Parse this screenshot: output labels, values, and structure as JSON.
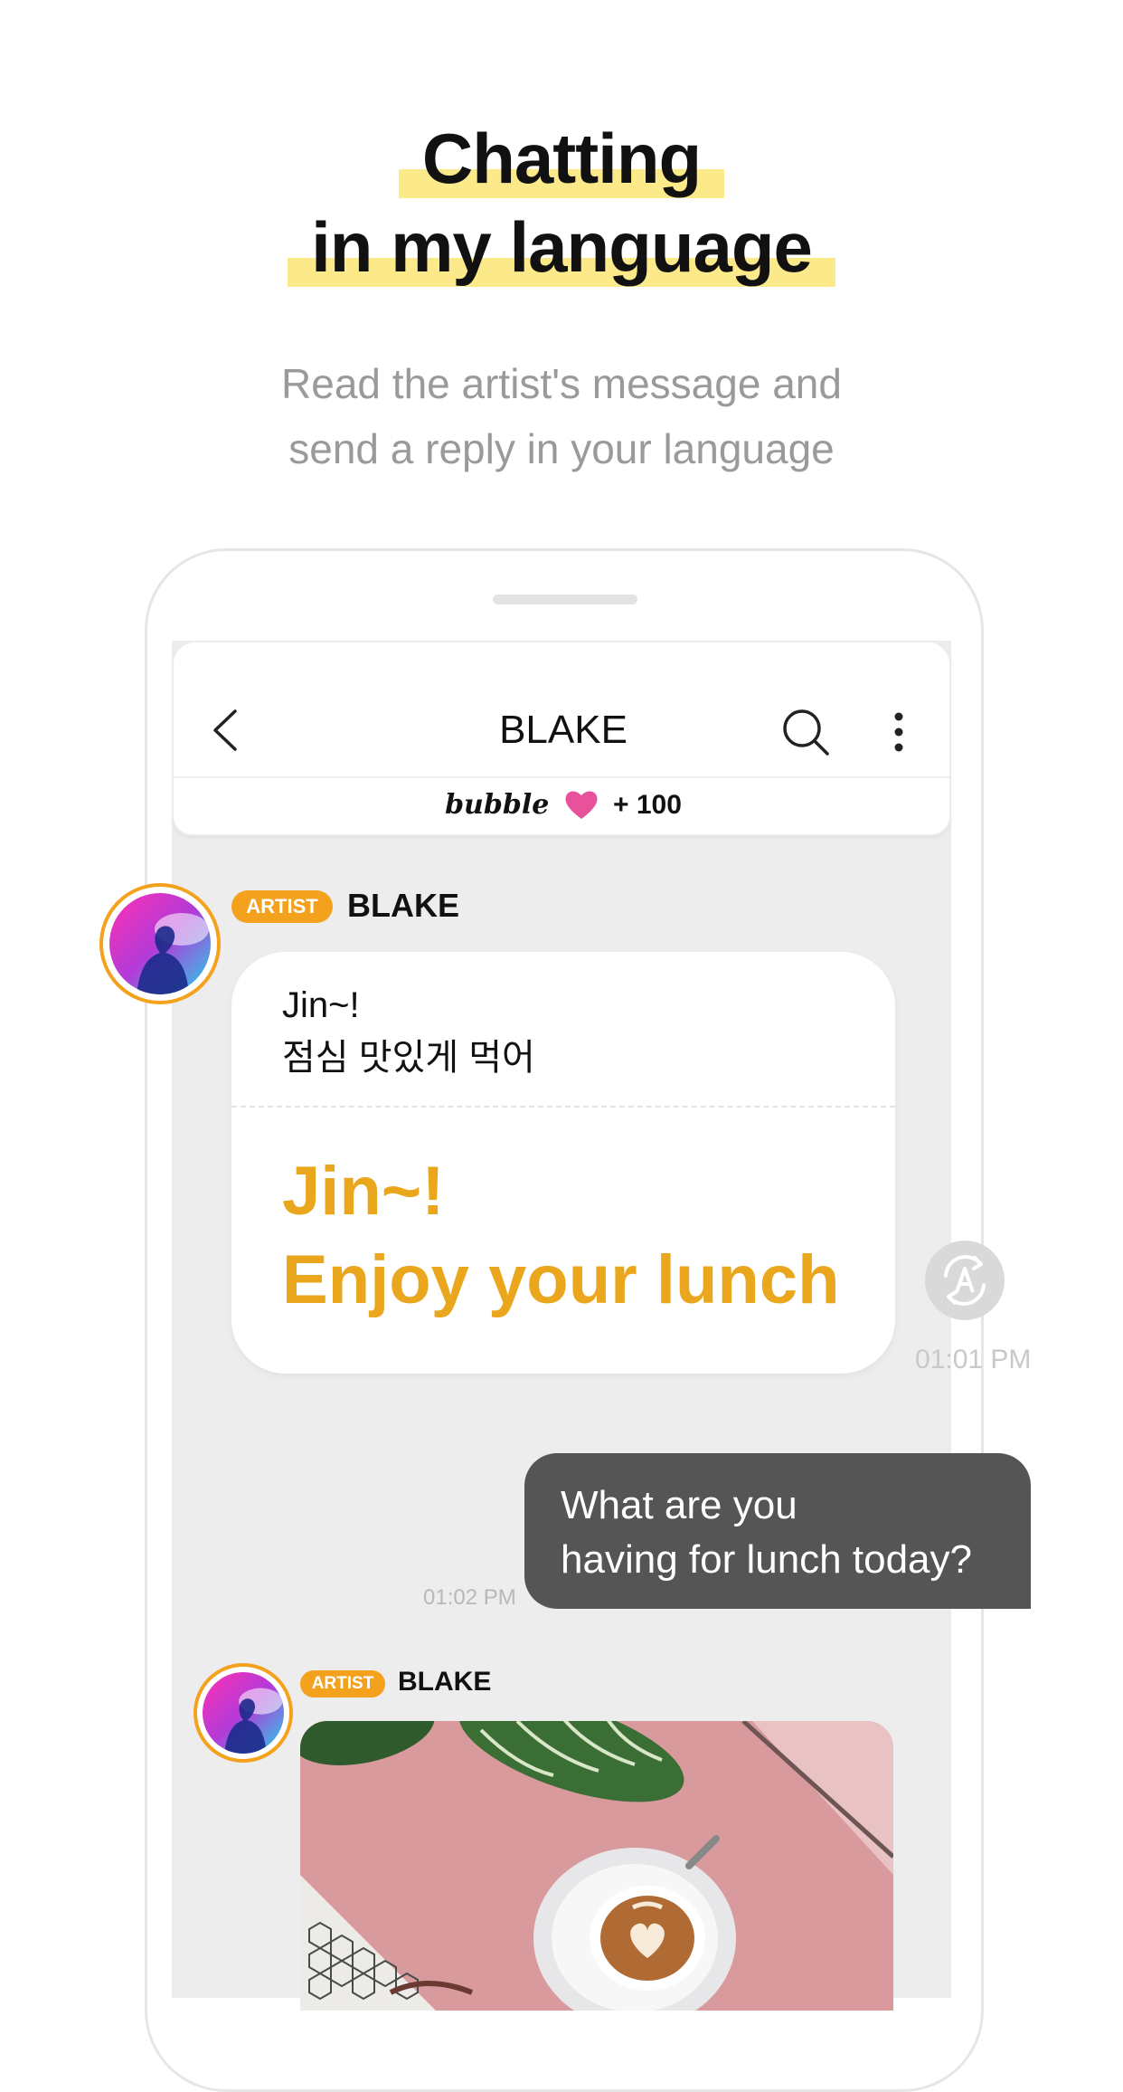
{
  "headline": {
    "line1": "Chatting",
    "line2": "in my language"
  },
  "subtitle": {
    "line1": "Read the artist's message and",
    "line2": "send a reply in your language"
  },
  "chat_header": {
    "title": "BLAKE",
    "bubble_logo": "bubble",
    "bubble_count": "+ 100"
  },
  "messages": {
    "first": {
      "badge": "ARTIST",
      "sender": "BLAKE",
      "original_line1": "Jin~!",
      "original_line2": "점심 맛있게 먹어",
      "translated_line1": "Jin~!",
      "translated_line2": "Enjoy your lunch",
      "time": "01:01 PM"
    },
    "reply": {
      "line1": "What are you",
      "line2": "having for lunch today?",
      "time": "01:02 PM"
    },
    "second": {
      "badge": "ARTIST",
      "sender": "BLAKE"
    }
  },
  "colors": {
    "accent_yellow": "#fbe98a",
    "artist_orange": "#f4a11d",
    "translation_text": "#eaa61c",
    "reply_bubble": "#555555",
    "heart_pink": "#e8529a"
  },
  "icons": [
    "back-chevron-icon",
    "search-icon",
    "more-vertical-icon",
    "heart-icon",
    "translate-icon"
  ]
}
